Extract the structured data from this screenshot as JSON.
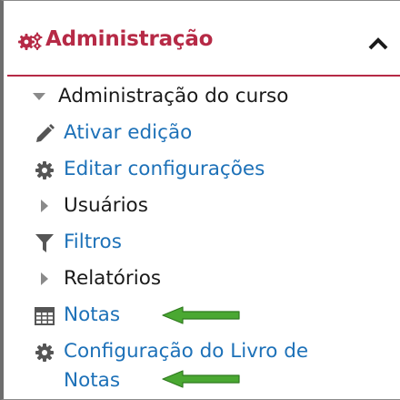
{
  "block": {
    "title": "Administração",
    "icon": "gears-icon",
    "collapse_icon": "chevron-up-icon",
    "accent_color": "#b62a46"
  },
  "tree": {
    "root": {
      "label": "Administração do curso",
      "icon": "caret-down-icon"
    },
    "items": [
      {
        "label": "Ativar edição",
        "icon": "pencil-icon",
        "type": "link"
      },
      {
        "label": "Editar configurações",
        "icon": "gear-icon",
        "type": "link"
      },
      {
        "label": "Usuários",
        "icon": "caret-right-icon",
        "type": "branch"
      },
      {
        "label": "Filtros",
        "icon": "filter-icon",
        "type": "link"
      },
      {
        "label": "Relatórios",
        "icon": "caret-right-icon",
        "type": "branch"
      },
      {
        "label": "Notas",
        "icon": "table-icon",
        "type": "link"
      },
      {
        "label_line1": "Configuração do Livro de",
        "label_line2": "Notas",
        "icon": "gear-icon",
        "type": "link"
      }
    ]
  },
  "annotations": {
    "arrow_icon": "green-arrow-left-icon",
    "arrow_color": "#4aa832"
  },
  "colors": {
    "link": "#1d71b8",
    "text": "#1a1a1a",
    "icon": "#555555"
  }
}
